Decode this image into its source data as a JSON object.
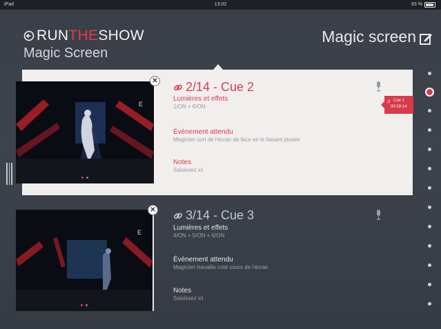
{
  "status_bar": {
    "device": "iPad",
    "time": "13:02",
    "battery": "93 %"
  },
  "header": {
    "logo_prefix": "RUN",
    "logo_accent": "THE",
    "logo_suffix": "SHOW",
    "subtitle": "Magic Screen",
    "screen_title": "Magic screen"
  },
  "cues": [
    {
      "title": "2/14 - Cue 2",
      "lights_label": "Lumières et effets",
      "lights_value": "1/ON + 6/ON",
      "event_label": "Évènement attendu",
      "event_value": "Magicien sort de l'écran de face en le faisant pivoter",
      "notes_label": "Notes",
      "notes_value": "Saisissez ici"
    },
    {
      "title": "3/14 - Cue 3",
      "lights_label": "Lumières et effets",
      "lights_value": "4/ON + 5/ON + 6/ON",
      "event_label": "Évènement attendu",
      "event_value": "Magicien travaille coté cours de l'écran",
      "notes_label": "Notes",
      "notes_value": "Saisissez ici"
    }
  ],
  "cue_tag": {
    "label": "Cue 1",
    "timecode": "00:19:14"
  },
  "thumb_badge": "E",
  "icons": [
    "back-arrow-icon",
    "edit-icon",
    "link-icon",
    "microphone-icon",
    "close-icon",
    "music-note-icon"
  ],
  "colors": {
    "accent": "#e03a4d",
    "background": "#3a3f48",
    "active_card": "#f1efee"
  }
}
